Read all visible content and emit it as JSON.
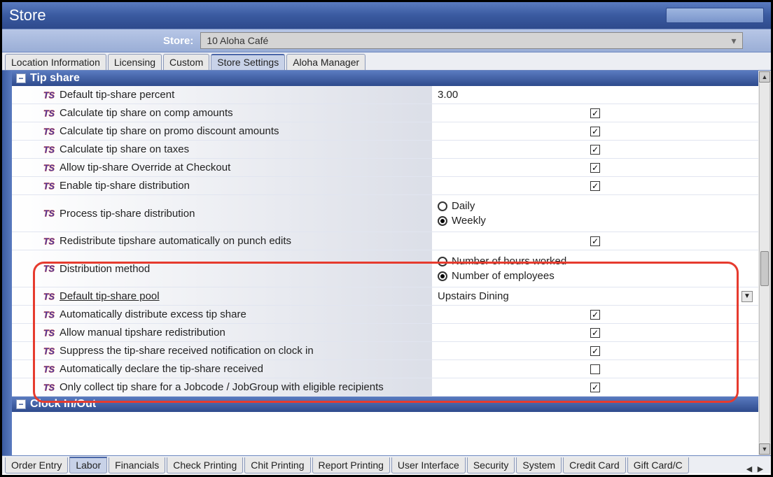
{
  "window": {
    "title": "Store"
  },
  "store_selector": {
    "label": "Store:",
    "value": "10 Aloha Café"
  },
  "top_tabs": [
    {
      "label": "Location Information",
      "active": false
    },
    {
      "label": "Licensing",
      "active": false
    },
    {
      "label": "Custom",
      "active": false
    },
    {
      "label": "Store Settings",
      "active": true
    },
    {
      "label": "Aloha Manager",
      "active": false
    }
  ],
  "sections": {
    "tip_share": {
      "title": "Tip share",
      "rows": [
        {
          "kind": "text",
          "label": "Default tip-share percent",
          "value": "3.00"
        },
        {
          "kind": "check",
          "label": "Calculate tip share on comp amounts",
          "checked": true
        },
        {
          "kind": "check",
          "label": "Calculate tip share on promo discount amounts",
          "checked": true
        },
        {
          "kind": "check",
          "label": "Calculate tip share on taxes",
          "checked": true
        },
        {
          "kind": "check",
          "label": "Allow tip-share Override at Checkout",
          "checked": true
        },
        {
          "kind": "check",
          "label": "Enable tip-share distribution",
          "checked": true
        },
        {
          "kind": "radio",
          "label": "Process tip-share distribution",
          "options": [
            "Daily",
            "Weekly"
          ],
          "selected": 1
        },
        {
          "kind": "check",
          "label": "Redistribute tipshare automatically on punch edits",
          "checked": true
        },
        {
          "kind": "radio",
          "label": "Distribution method",
          "options": [
            "Number of hours worked",
            "Number of employees"
          ],
          "selected": 1
        },
        {
          "kind": "dropdown",
          "label": "Default tip-share pool",
          "value": "Upstairs Dining",
          "underline": true
        },
        {
          "kind": "check",
          "label": "Automatically distribute excess tip share",
          "checked": true
        },
        {
          "kind": "check",
          "label": "Allow manual tipshare redistribution",
          "checked": true
        },
        {
          "kind": "check",
          "label": "Suppress the tip-share received notification on clock in",
          "checked": true
        },
        {
          "kind": "check",
          "label": "Automatically declare the tip-share received",
          "checked": false
        },
        {
          "kind": "check",
          "label": "Only collect tip share for a Jobcode / JobGroup with eligible recipients",
          "checked": true
        }
      ]
    },
    "clock": {
      "title": "Clock In/Out"
    }
  },
  "bottom_tabs": [
    {
      "label": "Order Entry",
      "active": false
    },
    {
      "label": "Labor",
      "active": true
    },
    {
      "label": "Financials",
      "active": false
    },
    {
      "label": "Check Printing",
      "active": false
    },
    {
      "label": "Chit Printing",
      "active": false
    },
    {
      "label": "Report Printing",
      "active": false
    },
    {
      "label": "User Interface",
      "active": false
    },
    {
      "label": "Security",
      "active": false
    },
    {
      "label": "System",
      "active": false
    },
    {
      "label": "Credit Card",
      "active": false
    },
    {
      "label": "Gift Card/C",
      "active": false
    }
  ],
  "icons": {
    "ts": "TS"
  }
}
